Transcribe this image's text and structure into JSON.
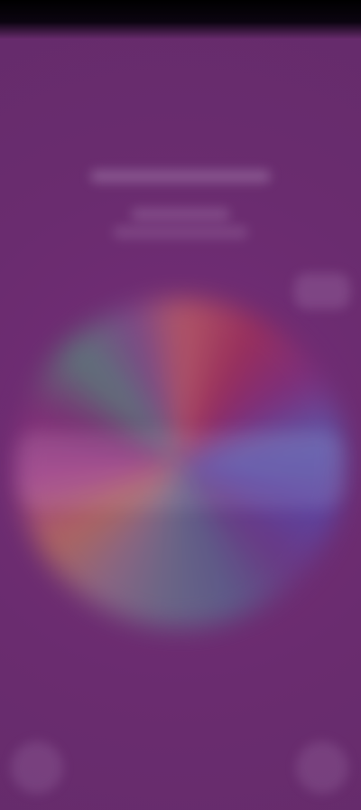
{
  "screen": {
    "background": "#6a2c6f"
  },
  "header": {
    "top_line": "",
    "bottom_line": ""
  },
  "wheel": {
    "title_text": "",
    "accent_colors": [
      "#9c2f5a",
      "#5a5cae",
      "#6a6a88",
      "#b36a5e",
      "#a33f8a",
      "#5c7a7a"
    ]
  },
  "controls": {
    "settings_icon": "settings-icon",
    "left_icon": "left-action-icon",
    "right_icon": "right-action-icon"
  }
}
